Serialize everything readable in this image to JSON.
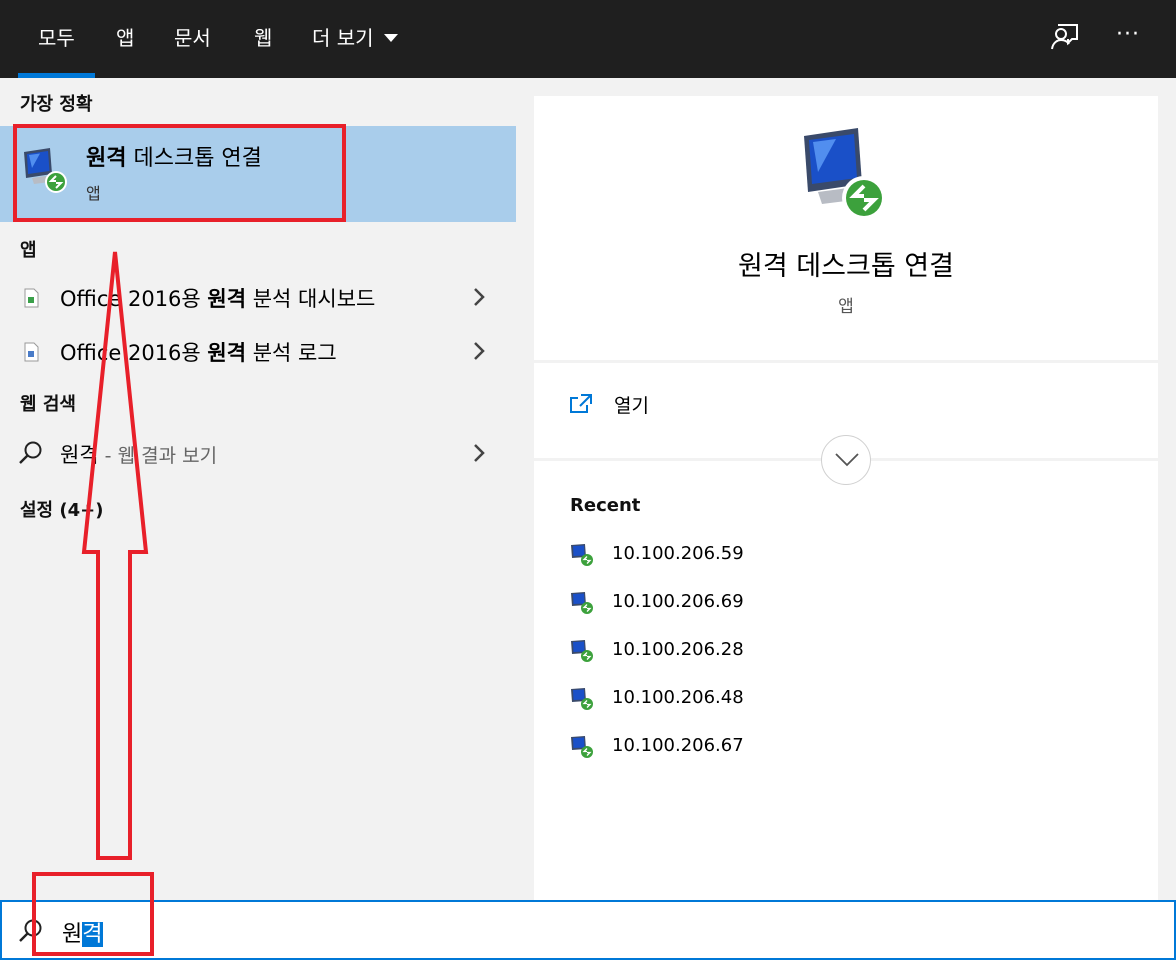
{
  "tabs": [
    {
      "label": "모두",
      "active": true
    },
    {
      "label": "앱",
      "active": false
    },
    {
      "label": "문서",
      "active": false
    },
    {
      "label": "웹",
      "active": false
    },
    {
      "label": "더 보기",
      "active": false
    }
  ],
  "topbar_icons": {
    "feedback": "feedback-person-icon",
    "more": "···"
  },
  "left": {
    "best_match_header": "가장 정확",
    "best_match": {
      "title_bold": "원격",
      "title_rest": " 데스크톱 연결",
      "subtitle": "앱"
    },
    "apps_header": "앱",
    "apps": [
      {
        "prefix": "Office 2016용 ",
        "bold": "원격",
        "suffix": " 분석 대시보드"
      },
      {
        "prefix": "Office 2016용 ",
        "bold": "원격",
        "suffix": " 분석 로그"
      }
    ],
    "web_header": "웹 검색",
    "web_item": {
      "query": "원격",
      "hint": " - 웹 결과 보기"
    },
    "settings_header": "설정 (4+)"
  },
  "detail": {
    "title": "원격 데스크톱 연결",
    "subtitle": "앱",
    "open_label": "열기",
    "recent_header": "Recent",
    "recent": [
      "10.100.206.59",
      "10.100.206.69",
      "10.100.206.28",
      "10.100.206.48",
      "10.100.206.67"
    ]
  },
  "search": {
    "typed": "원",
    "selected": "격"
  },
  "colors": {
    "accent": "#0078d7",
    "selection": "#a9cdeb",
    "topbar": "#1f1f1f",
    "annotation": "#e8202a"
  }
}
